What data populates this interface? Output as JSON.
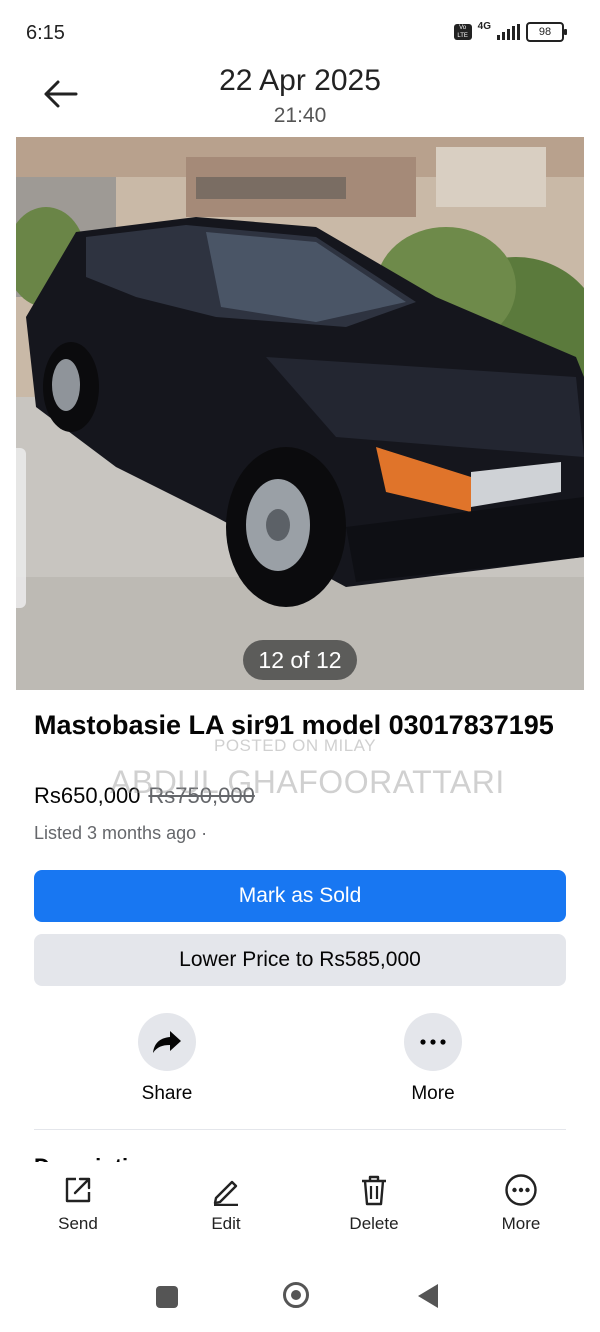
{
  "status_bar": {
    "time": "6:15",
    "network": "4G",
    "battery": "98"
  },
  "header": {
    "date": "22 Apr 2025",
    "time": "21:40"
  },
  "photo": {
    "counter": "12 of 12"
  },
  "listing": {
    "title": "Mastobasie LA sir91 model 03017837195",
    "price": "Rs650,000",
    "original_price": "Rs750,000",
    "listed": "Listed 3 months ago ·",
    "watermark_line1": "POSTED ON MILAY",
    "watermark_line2": "ABDUL GHAFOORATTARI"
  },
  "buttons": {
    "mark_sold": "Mark as Sold",
    "lower_price": "Lower Price to Rs585,000"
  },
  "actions": {
    "share": "Share",
    "more": "More"
  },
  "description": {
    "heading": "Description"
  },
  "toolbar": {
    "send": "Send",
    "edit": "Edit",
    "delete": "Delete",
    "more": "More"
  },
  "colors": {
    "primary": "#1877f2",
    "secondary_bg": "#e4e6eb",
    "muted_text": "#65676b"
  }
}
